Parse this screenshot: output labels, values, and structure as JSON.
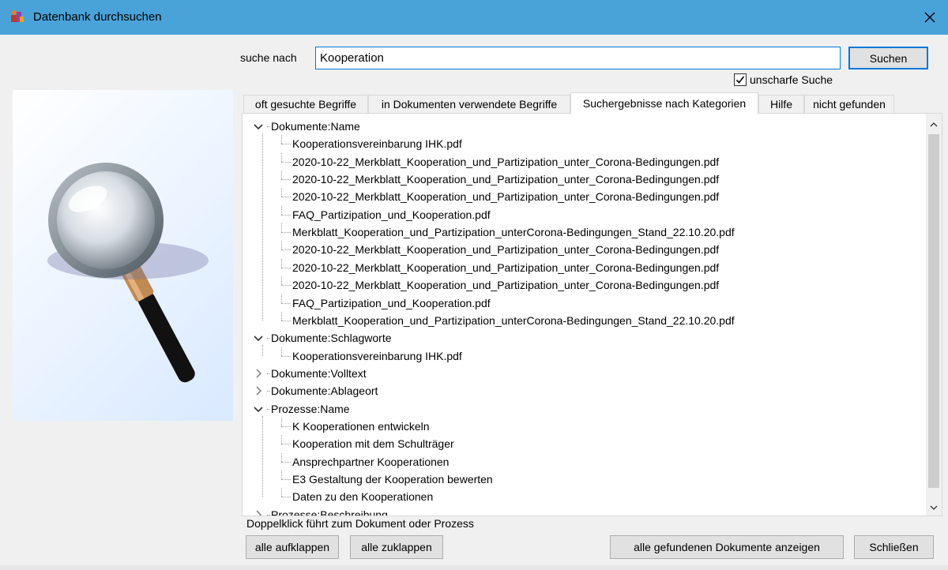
{
  "window": {
    "title": "Datenbank durchsuchen"
  },
  "search": {
    "label": "suche nach",
    "value": "Kooperation",
    "button": "Suchen",
    "fuzzy_label": "unscharfe Suche",
    "fuzzy_checked": true
  },
  "tabs": [
    {
      "label": "oft gesuchte Begriffe"
    },
    {
      "label": "in Dokumenten verwendete Begriffe"
    },
    {
      "label": "Suchergebnisse nach Kategorien",
      "active": true
    },
    {
      "label": "Hilfe"
    },
    {
      "label": "nicht gefunden"
    }
  ],
  "tree": {
    "categories": [
      {
        "label": "Dokumente:Name",
        "expanded": true,
        "items": [
          "Kooperationsvereinbarung IHK.pdf",
          "2020-10-22_Merkblatt_Kooperation_und_Partizipation_unter_Corona-Bedingungen.pdf",
          "2020-10-22_Merkblatt_Kooperation_und_Partizipation_unter_Corona-Bedingungen.pdf",
          "2020-10-22_Merkblatt_Kooperation_und_Partizipation_unter_Corona-Bedingungen.pdf",
          "FAQ_Partizipation_und_Kooperation.pdf",
          "Merkblatt_Kooperation_und_Partizipation_unterCorona-Bedingungen_Stand_22.10.20.pdf",
          "2020-10-22_Merkblatt_Kooperation_und_Partizipation_unter_Corona-Bedingungen.pdf",
          "2020-10-22_Merkblatt_Kooperation_und_Partizipation_unter_Corona-Bedingungen.pdf",
          "2020-10-22_Merkblatt_Kooperation_und_Partizipation_unter_Corona-Bedingungen.pdf",
          "FAQ_Partizipation_und_Kooperation.pdf",
          "Merkblatt_Kooperation_und_Partizipation_unterCorona-Bedingungen_Stand_22.10.20.pdf"
        ]
      },
      {
        "label": "Dokumente:Schlagworte",
        "expanded": true,
        "items": [
          "Kooperationsvereinbarung IHK.pdf"
        ]
      },
      {
        "label": "Dokumente:Volltext",
        "expanded": false,
        "items": []
      },
      {
        "label": "Dokumente:Ablageort",
        "expanded": false,
        "items": []
      },
      {
        "label": "Prozesse:Name",
        "expanded": true,
        "items": [
          "K Kooperationen entwickeln",
          "Kooperation mit dem Schulträger",
          "Ansprechpartner Kooperationen",
          "E3 Gestaltung der Kooperation bewerten",
          "Daten zu den Kooperationen"
        ]
      },
      {
        "label": "Prozesse:Beschreibung",
        "expanded": false,
        "items": []
      }
    ]
  },
  "hint": "Doppelklick führt zum Dokument oder Prozess",
  "buttons": {
    "expand_all": "alle aufklappen",
    "collapse_all": "alle zuklappen",
    "show_all_docs": "alle gefundenen Dokumente anzeigen",
    "close": "Schließen"
  },
  "colors": {
    "titlebar": "#4aa3d8",
    "accent": "#0078d7"
  },
  "icons": {
    "app": "app-icon",
    "close": "close-icon",
    "magnifier": "magnifying-glass-icon",
    "expanded": "chevron-down-icon",
    "collapsed": "chevron-right-icon"
  }
}
